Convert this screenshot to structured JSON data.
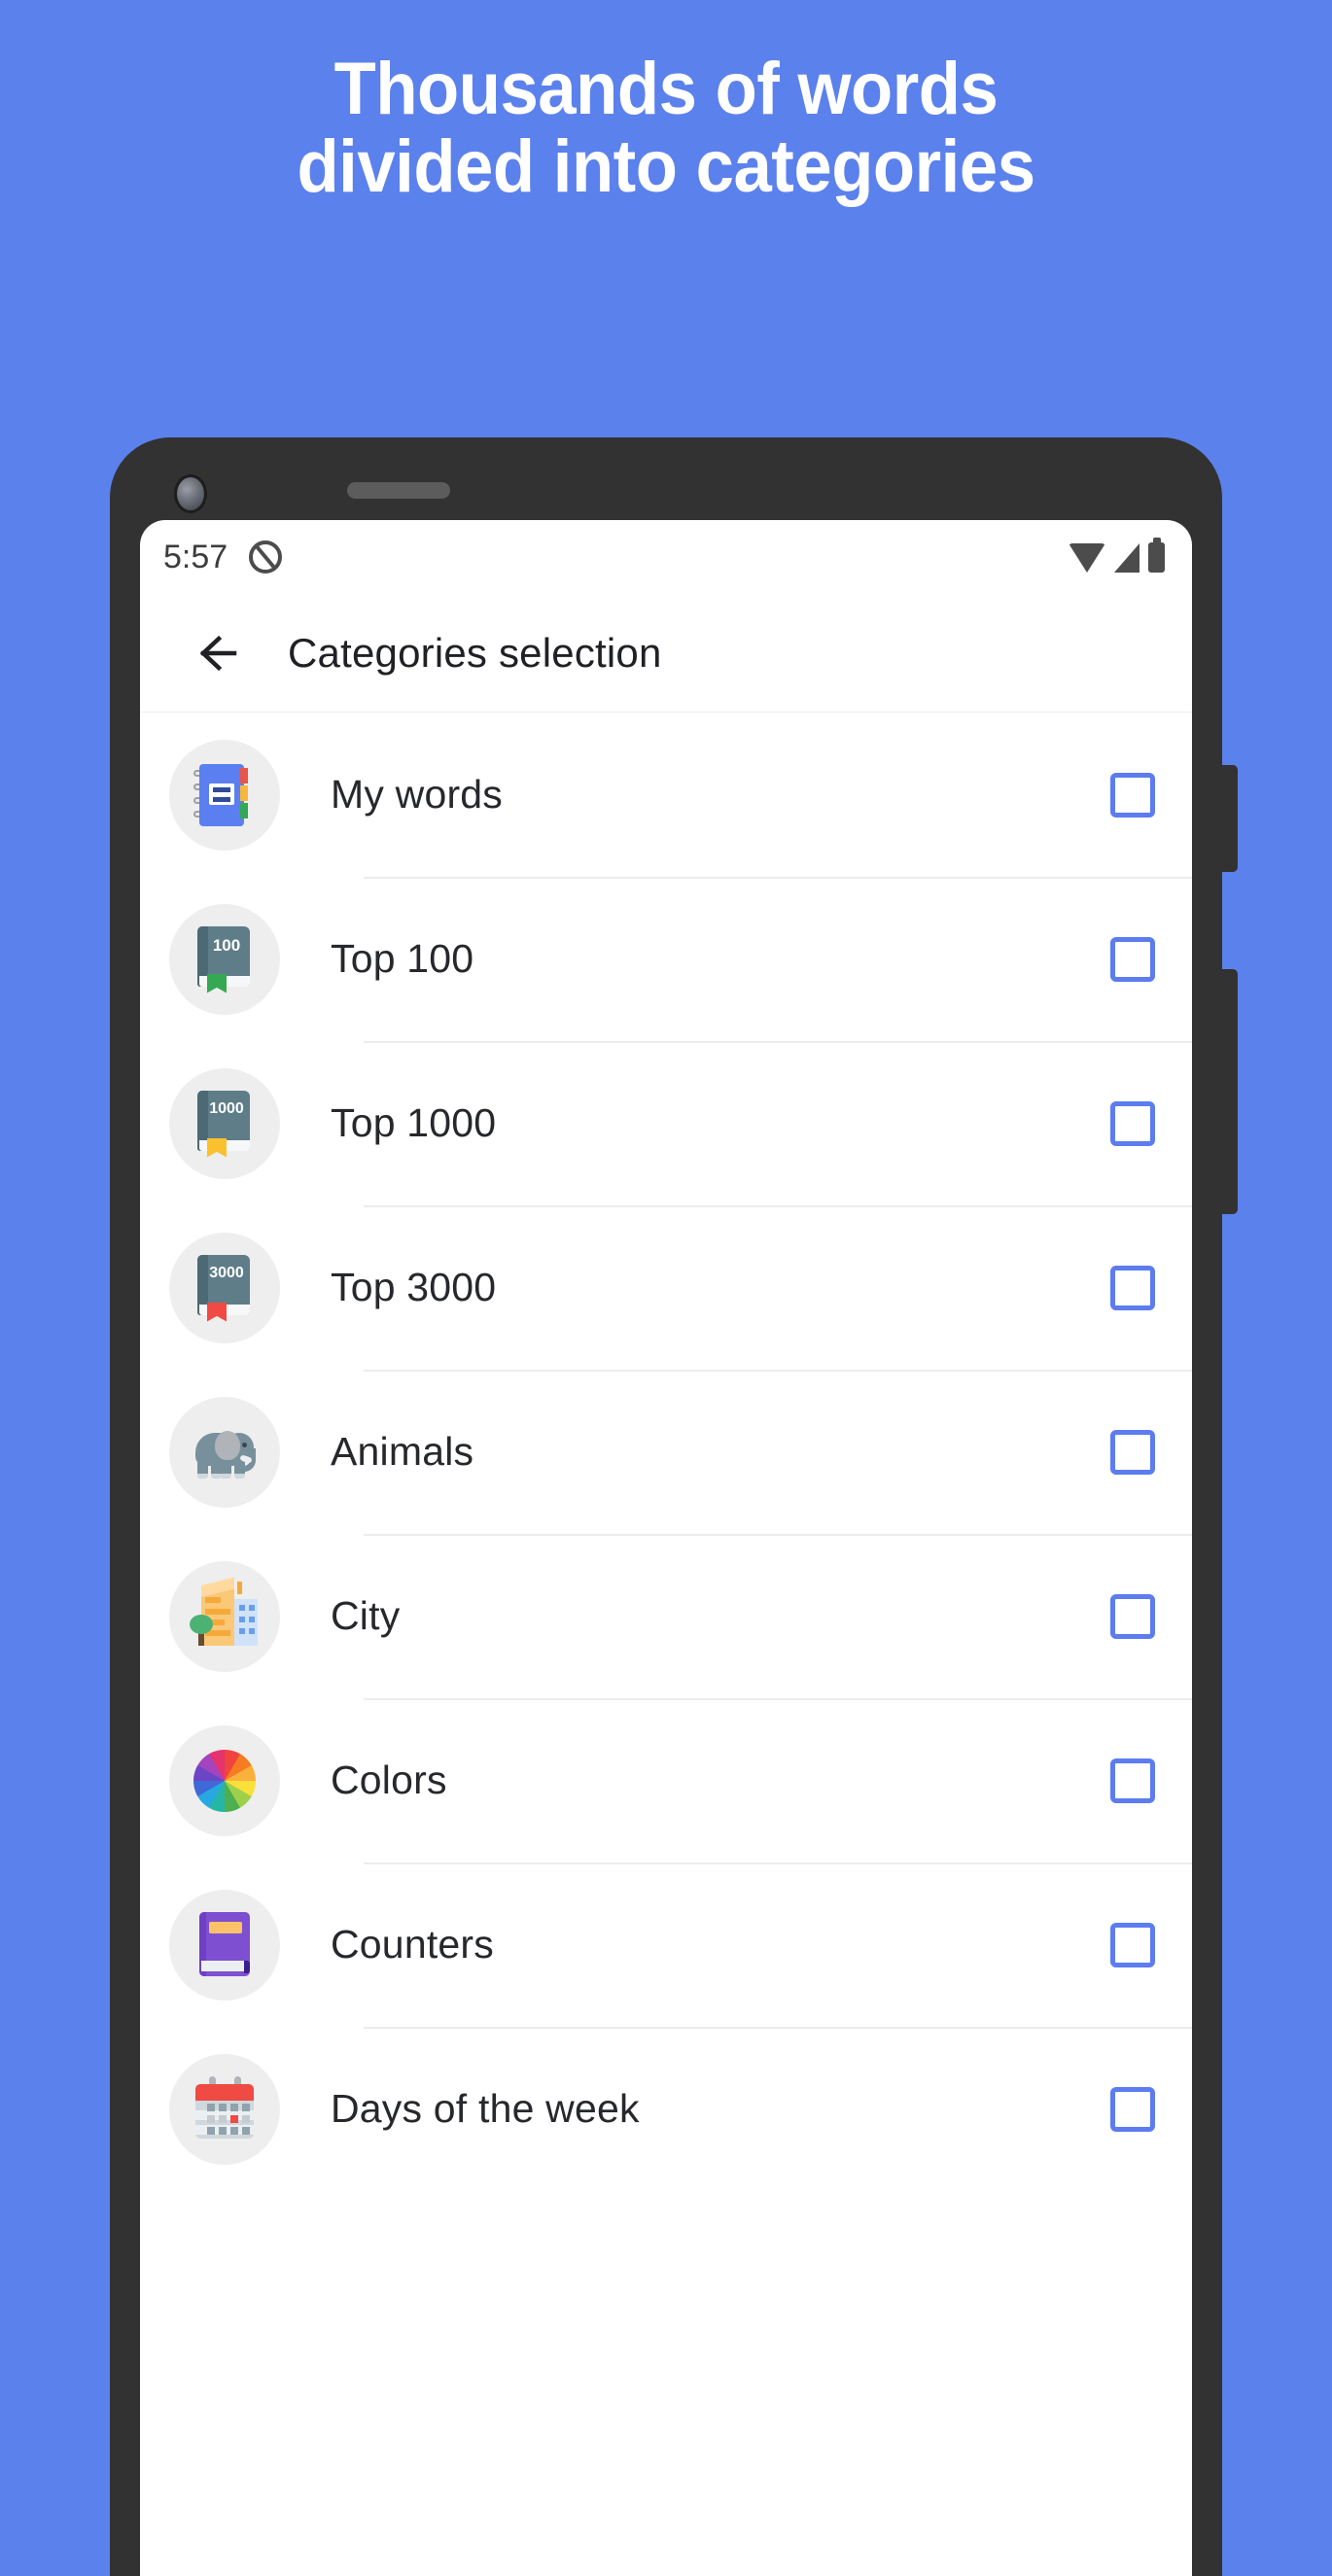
{
  "promo": {
    "background_color": "#5b81ec",
    "headline_line1": "Thousands of words",
    "headline_line2": "divided into categories"
  },
  "device": {
    "frame_color": "#323232",
    "camera_icon": "front-camera-icon",
    "speaker_icon": "earpiece-speaker-icon",
    "volume_button": "volume-rocker",
    "power_button": "power-button"
  },
  "statusbar": {
    "time": "5:57",
    "dnd_icon": "do-not-disturb-icon",
    "wifi_icon": "wifi-icon",
    "signal_icon": "cellular-signal-icon",
    "battery_icon": "battery-full-icon"
  },
  "appbar": {
    "back_icon": "back-arrow-icon",
    "title": "Categories selection"
  },
  "list": {
    "checkbox_color": "#5c7cf0",
    "items": [
      {
        "label": "My words",
        "icon": "notebook-icon",
        "checked": false
      },
      {
        "label": "Top 100",
        "icon": "book-100-icon",
        "checked": false,
        "book_number": "100",
        "bookmark_color": "#34a853"
      },
      {
        "label": "Top 1000",
        "icon": "book-1000-icon",
        "checked": false,
        "book_number": "1000",
        "bookmark_color": "#fbc02d"
      },
      {
        "label": "Top 3000",
        "icon": "book-3000-icon",
        "checked": false,
        "book_number": "3000",
        "bookmark_color": "#ef4a43"
      },
      {
        "label": "Animals",
        "icon": "elephant-icon",
        "checked": false
      },
      {
        "label": "City",
        "icon": "cityscape-icon",
        "checked": false
      },
      {
        "label": "Colors",
        "icon": "color-wheel-icon",
        "checked": false
      },
      {
        "label": "Counters",
        "icon": "purple-book-icon",
        "checked": false
      },
      {
        "label": "Days of the week",
        "icon": "calendar-icon",
        "checked": false
      }
    ]
  }
}
